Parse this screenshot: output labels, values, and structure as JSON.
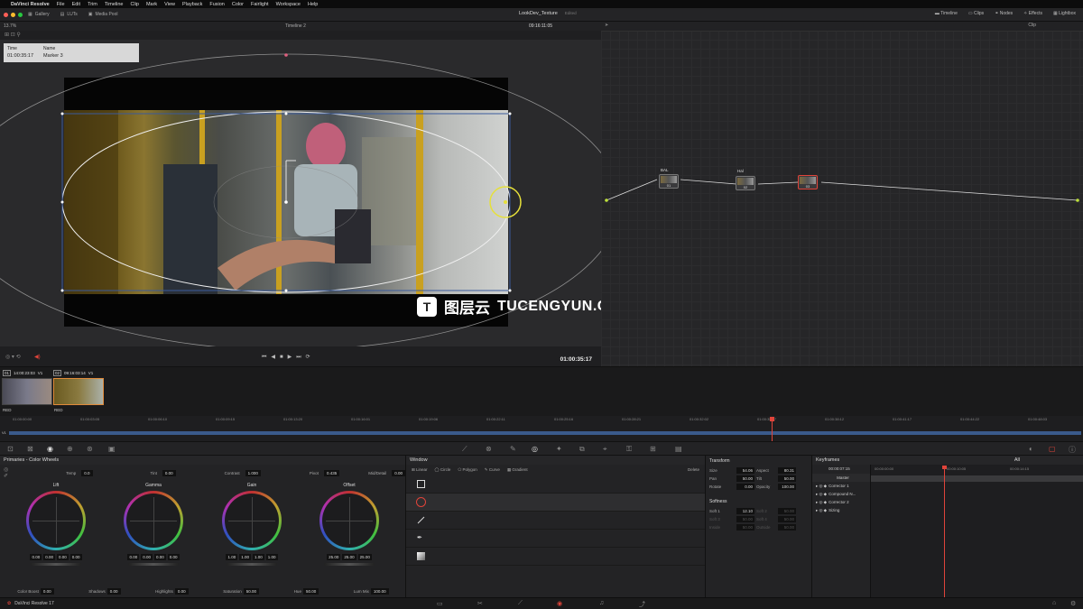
{
  "menubar": {
    "app": "DaVinci Resolve",
    "items": [
      "File",
      "Edit",
      "Trim",
      "Timeline",
      "Clip",
      "Mark",
      "View",
      "Playback",
      "Fusion",
      "Color",
      "Fairlight",
      "Workspace",
      "Help"
    ]
  },
  "toolbar": {
    "gallery": "Gallery",
    "luts": "LUTs",
    "media_pool": "Media Pool",
    "project": "LookDev_Texture",
    "edited": "Edited",
    "timeline": "Timeline",
    "clips": "Clips",
    "nodes": "Nodes",
    "effects": "Effects",
    "lightbox": "Lightbox"
  },
  "viewer": {
    "zoom": "13.7%",
    "timeline_name": "Timeline 2",
    "timecode_top": "09:16:11:05",
    "timecode": "01:00:35:17",
    "clip_mode": "Clip"
  },
  "marker": {
    "time_label": "Time",
    "name_label": "Name",
    "time": "01:00:35:17",
    "name": "Marker 3"
  },
  "nodes": [
    {
      "label": "BAL",
      "num": "01"
    },
    {
      "label": "Hal",
      "num": "02"
    },
    {
      "label": "",
      "num": "03"
    }
  ],
  "clips": [
    {
      "index": "01",
      "timecode": "14:00:23:03",
      "track": "V1",
      "codec": "RED"
    },
    {
      "index": "02",
      "timecode": "09:16:03:14",
      "track": "V1",
      "codec": "RED"
    }
  ],
  "ruler_ticks": [
    "01:00:00:00",
    "01:00:03:05",
    "01:00:06:10",
    "01:00:09:15",
    "01:00:13:20",
    "01:00:16:01",
    "01:00:19:06",
    "01:00:22:11",
    "01:00:25:16",
    "01:00:28:21",
    "01:00:32:02",
    "01:00:35:07",
    "01:00:38:12",
    "01:00:41:17",
    "01:00:44:22",
    "01:00:48:03"
  ],
  "track_label": "V1",
  "primaries": {
    "title": "Primaries - Color Wheels",
    "temp_label": "Temp",
    "temp": "0.0",
    "tint_label": "Tint",
    "tint": "0.00",
    "contrast_label": "Contrast",
    "contrast": "1.000",
    "pivot_label": "Pivot",
    "pivot": "0.435",
    "middetail_label": "Mid/Detail",
    "middetail": "0.00",
    "wheels": [
      {
        "name": "Lift",
        "vals": [
          "0.00",
          "0.00",
          "0.00",
          "0.00"
        ]
      },
      {
        "name": "Gamma",
        "vals": [
          "0.00",
          "0.00",
          "0.00",
          "0.00"
        ]
      },
      {
        "name": "Gain",
        "vals": [
          "1.00",
          "1.00",
          "1.00",
          "1.00"
        ]
      },
      {
        "name": "Offset",
        "vals": [
          "25.00",
          "25.00",
          "25.00"
        ]
      }
    ],
    "colorboost_label": "Color Boost",
    "colorboost": "0.00",
    "shadows_label": "Shadows",
    "shadows": "0.00",
    "highlights_label": "Highlights",
    "highlights": "0.00",
    "saturation_label": "Saturation",
    "saturation": "50.00",
    "hue_label": "Hue",
    "hue": "50.00",
    "lummix_label": "Lum Mix",
    "lummix": "100.00"
  },
  "window": {
    "title": "Window",
    "tools": [
      "Linear",
      "Circle",
      "Polygon",
      "Curve",
      "Gradient"
    ],
    "delete": "Delete"
  },
  "transform": {
    "title": "Transform",
    "size_label": "Size",
    "size": "54.06",
    "aspect_label": "Aspect",
    "aspect": "80.31",
    "pan_label": "Pan",
    "pan": "50.00",
    "tilt_label": "Tilt",
    "tilt": "50.00",
    "rotate_label": "Rotate",
    "rotate": "0.00",
    "opacity_label": "Opacity",
    "opacity": "100.00",
    "softness_title": "Softness",
    "soft1_label": "Soft 1",
    "soft1": "12.10",
    "soft2_label": "Soft 2",
    "soft2": "50.00",
    "soft3_label": "Soft 3",
    "soft3": "50.00",
    "soft4_label": "Soft 4",
    "soft4": "50.00",
    "inside_label": "Inside",
    "inside": "50.00",
    "outside_label": "Outside",
    "outside": "50.00"
  },
  "keyframes": {
    "title": "Keyframes",
    "filter": "All",
    "timecode": "00:00:07:15",
    "tick_start": "00:00:00:00",
    "tick_mid": "00:00:10:05",
    "tick_end": "00:00:14:15",
    "rows": [
      "Master",
      "Corrector 1",
      "Compound N...",
      "Corrector 2",
      "Sizing"
    ]
  },
  "status": {
    "app": "DaVinci Resolve 17"
  },
  "watermark": {
    "cn": "图层云",
    "en": "TUCENGYUN.COM"
  },
  "colors": {
    "accent_red": "#e0443a",
    "selection_yellow": "#e6e03a",
    "track_blue": "#3a5a8c"
  }
}
